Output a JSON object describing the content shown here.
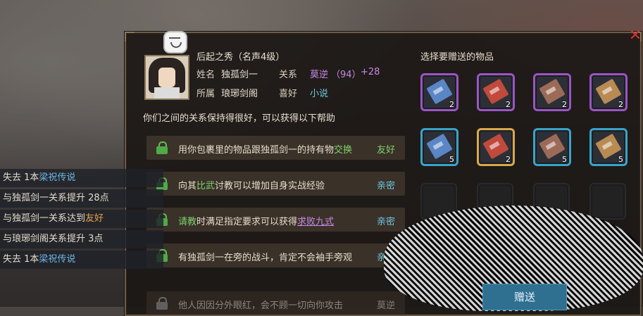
{
  "character": {
    "name_line": "后起之秀（名声4级）",
    "name_label": "姓名",
    "name_value": "独孤剑一",
    "relation_label": "关系",
    "relation_value": "莫逆",
    "relation_points": "（94）",
    "relation_delta": "+28",
    "faction_label": "所属",
    "faction_value": "琅琊剑阁",
    "hobby_label": "喜好",
    "hobby_value": "小说"
  },
  "summary_text": "你们之间的关系保持得很好，可以获得以下帮助",
  "help_items": [
    {
      "pre": "用你包裹里的物品跟独孤剑一的持有物",
      "hl": "交换",
      "post": "",
      "relation": "友好"
    },
    {
      "pre": "向其",
      "hl": "比武",
      "post": "讨教可以增加自身实战经验",
      "relation": "亲密"
    },
    {
      "pre": "",
      "hl": "请教",
      "post": "时满足指定要求可以获得",
      "link": "求败九式",
      "relation": "亲密"
    },
    {
      "pre": "有独孤剑一在旁的战斗，肯定不会袖手旁观",
      "hl": "",
      "post": "",
      "relation": "亲密"
    },
    {
      "pre": "他人因因分外眼红，会不顾一切向你攻击",
      "hl": "",
      "post": "",
      "relation": "莫逆"
    }
  ],
  "gift_panel": {
    "title": "选择要赠送的物品",
    "items": [
      {
        "name": "blue-manual",
        "qty": "2",
        "border": "purple",
        "color": "#5a86c6"
      },
      {
        "name": "red-manual",
        "qty": "2",
        "border": "purple",
        "color": "#c04a3c"
      },
      {
        "name": "brown-manual",
        "qty": "2",
        "border": "purple",
        "color": "#9c6b57"
      },
      {
        "name": "tan-manual",
        "qty": "2",
        "border": "purple",
        "color": "#b88b52"
      },
      {
        "name": "blue-manual",
        "qty": "5",
        "border": "blue",
        "color": "#5a86c6"
      },
      {
        "name": "red-manual",
        "qty": "2",
        "border": "gold",
        "color": "#c04a3c"
      },
      {
        "name": "brown-manual",
        "qty": "5",
        "border": "blue",
        "color": "#9c6b57"
      },
      {
        "name": "tan-manual",
        "qty": "5",
        "border": "blue",
        "color": "#b88b52"
      }
    ],
    "button_label": "赠送"
  },
  "chat_log": [
    {
      "pre": "失去 1本",
      "hl": "梁祝传说",
      "hl_color": "blue",
      "post": ""
    },
    {
      "pre": "与独孤剑一关系提升 28点",
      "hl": "",
      "post": ""
    },
    {
      "pre": "与独孤剑一关系达到",
      "hl": "友好",
      "hl_color": "orange",
      "post": ""
    },
    {
      "pre": "与琅琊剑阁关系提升 3点",
      "hl": "",
      "post": ""
    },
    {
      "pre": "失去 1本",
      "hl": "梁祝传说",
      "hl_color": "blue",
      "post": ""
    }
  ],
  "colors": {
    "accent_purple": "#c788e6",
    "accent_cyan": "#6fc7e0",
    "accent_green": "#7cd36a",
    "close_red": "#cc3333"
  }
}
